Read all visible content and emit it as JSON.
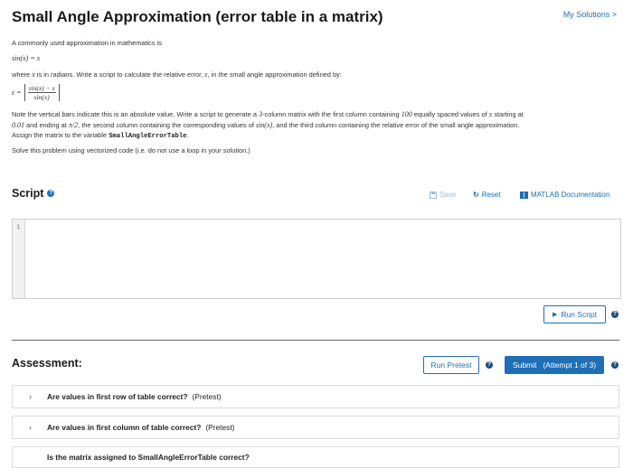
{
  "header": {
    "title": "Small Angle Approximation (error table in a matrix)",
    "my_solutions": "My Solutions >"
  },
  "problem": {
    "intro": "A commonly used approximation in mathematics is",
    "approx_formula": "sin(x) = x",
    "p2_a": "where ",
    "p2_var": "x",
    "p2_b": " is in radians. Write a script to calculate the relative error, ",
    "p2_eps": "ε",
    "p2_c": ", in the small angle approximation defined by:",
    "err_lhs": "ε =",
    "err_num": "sin(x) − x",
    "err_den": "sin(x)",
    "note_1a": "Note the vertical bars indicate this is an absolute value.  Write a script to generate a ",
    "note_1b": "3",
    "note_1c": "-column matrix with the first column containing ",
    "note_1d": "100",
    "note_1e": " equally spaced values of ",
    "note_1f": "x",
    "note_1g": " starting at",
    "note_2a": "0.01",
    "note_2b": " and ending at ",
    "note_2c": "π/2",
    "note_2d": ", the second column containing the corresponding values of ",
    "note_2e": "sin(x)",
    "note_2f": ", and the third column containing the relative error of the small angle approximation.",
    "note_3a": "Assign the matrix to the variable ",
    "note_3b": "SmallAngleErrorTable",
    "note_3c": ".",
    "vectorized": "Solve this problem using vectorized code (i.e. do not use a loop in your solution.)"
  },
  "script": {
    "heading": "Script",
    "save_label": "Save",
    "reset_label": "Reset",
    "doc_label": "MATLAB Documentation",
    "line_number": "1",
    "run_label": "Run Script"
  },
  "assessment": {
    "heading": "Assessment:",
    "pretest_label": "Run Pretest",
    "submit_label": "Submit   (Attempt 1 of 3)",
    "items": [
      {
        "text": "Are values in first row of table correct?",
        "tag": "(Pretest)"
      },
      {
        "text": "Are values in first column of table correct?",
        "tag": "(Pretest)"
      },
      {
        "text": "Is the matrix assigned to SmallAngleErrorTable correct?",
        "tag": ""
      }
    ]
  },
  "colors": {
    "accent": "#1f6fb5",
    "submit_bg": "#1f6fb5"
  }
}
